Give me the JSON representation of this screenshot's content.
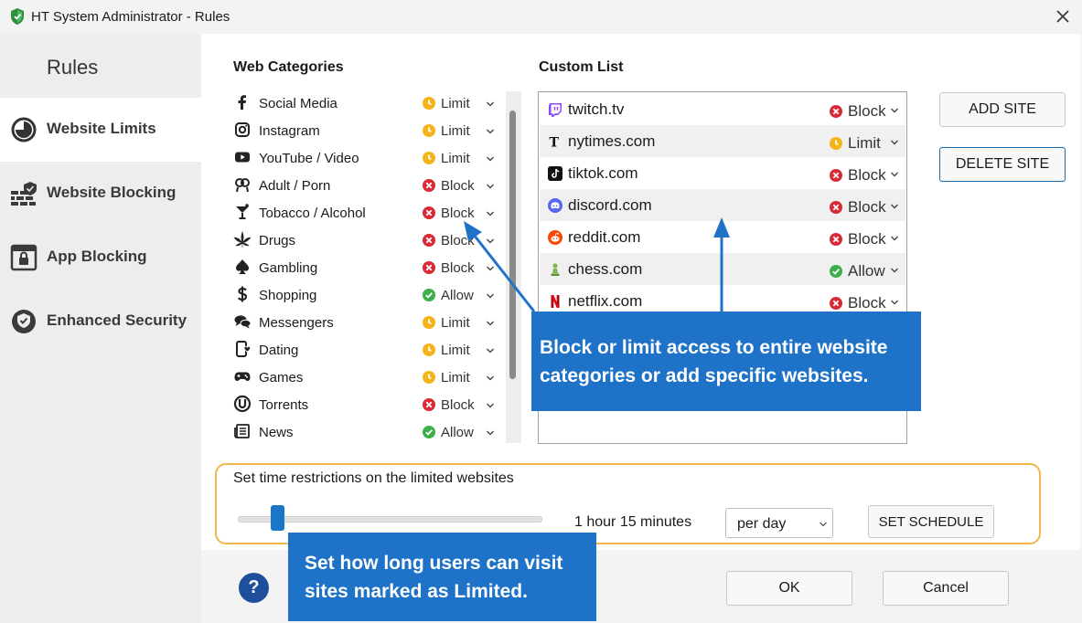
{
  "window": {
    "title": "HT System Administrator - Rules"
  },
  "sidebar": {
    "heading": "Rules",
    "items": [
      {
        "label": "Website Limits",
        "icon": "clock-icon",
        "active": true
      },
      {
        "label": "Website Blocking",
        "icon": "firewall-icon",
        "active": false
      },
      {
        "label": "App Blocking",
        "icon": "app-lock-icon",
        "active": false
      },
      {
        "label": "Enhanced Security",
        "icon": "shield-check-icon",
        "active": false
      }
    ]
  },
  "web_categories": {
    "title": "Web Categories",
    "items": [
      {
        "label": "Social Media",
        "icon": "facebook-icon",
        "status": "Limit"
      },
      {
        "label": "Instagram",
        "icon": "instagram-icon",
        "status": "Limit"
      },
      {
        "label": "YouTube / Video",
        "icon": "youtube-icon",
        "status": "Limit"
      },
      {
        "label": "Adult / Porn",
        "icon": "adult-icon",
        "status": "Block"
      },
      {
        "label": "Tobacco / Alcohol",
        "icon": "cocktail-icon",
        "status": "Block"
      },
      {
        "label": "Drugs",
        "icon": "cannabis-leaf-icon",
        "status": "Block"
      },
      {
        "label": "Gambling",
        "icon": "spade-icon",
        "status": "Block"
      },
      {
        "label": "Shopping",
        "icon": "dollar-icon",
        "status": "Allow"
      },
      {
        "label": "Messengers",
        "icon": "chat-bubbles-icon",
        "status": "Limit"
      },
      {
        "label": "Dating",
        "icon": "dating-phone-icon",
        "status": "Limit"
      },
      {
        "label": "Games",
        "icon": "gamepad-icon",
        "status": "Limit"
      },
      {
        "label": "Torrents",
        "icon": "torrent-icon",
        "status": "Block"
      },
      {
        "label": "News",
        "icon": "newspaper-icon",
        "status": "Allow"
      }
    ]
  },
  "custom_list": {
    "title": "Custom List",
    "items": [
      {
        "label": "twitch.tv",
        "icon": "twitch-icon",
        "status": "Block"
      },
      {
        "label": "nytimes.com",
        "icon": "nytimes-icon",
        "status": "Limit"
      },
      {
        "label": "tiktok.com",
        "icon": "tiktok-icon",
        "status": "Block"
      },
      {
        "label": "discord.com",
        "icon": "discord-icon",
        "status": "Block"
      },
      {
        "label": "reddit.com",
        "icon": "reddit-icon",
        "status": "Block"
      },
      {
        "label": "chess.com",
        "icon": "chess-pawn-icon",
        "status": "Allow"
      },
      {
        "label": "netflix.com",
        "icon": "netflix-icon",
        "status": "Block"
      }
    ],
    "add_label": "ADD SITE",
    "delete_label": "DELETE SITE"
  },
  "callouts": {
    "categories": {
      "line1": "Block or limit access to entire website",
      "line2": "categories or add specific websites."
    },
    "time": {
      "line1": "Set how long users can visit",
      "line2": "sites marked as Limited."
    }
  },
  "time_restrictions": {
    "label": "Set time restrictions on the limited websites",
    "slider_fraction": 0.13,
    "duration": "1 hour 15 minutes",
    "period": "per day",
    "schedule_label": "SET SCHEDULE"
  },
  "footer": {
    "ok_label": "OK",
    "cancel_label": "Cancel"
  },
  "colors": {
    "block": "#d72a36",
    "limit": "#f4b41a",
    "allow": "#3cae4a",
    "callout": "#1e73c8",
    "highlight": "#f3b64a",
    "slider": "#1a76c7"
  }
}
